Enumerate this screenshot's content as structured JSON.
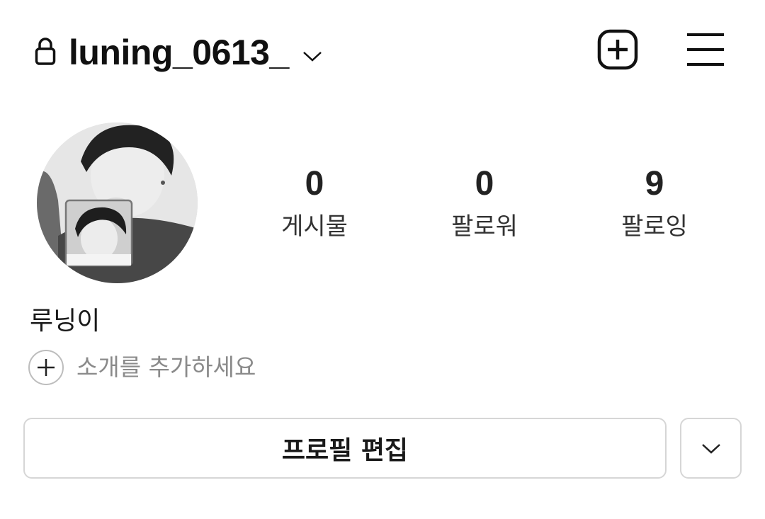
{
  "header": {
    "username": "luning_0613_",
    "icons": {
      "lock": "lock-icon",
      "account_switch": "chevron-down-icon",
      "new_post": "plus-square-icon",
      "menu": "hamburger-menu-icon"
    }
  },
  "profile": {
    "avatar": "profile-photo",
    "stats": [
      {
        "value": "0",
        "label": "게시물"
      },
      {
        "value": "0",
        "label": "팔로워"
      },
      {
        "value": "9",
        "label": "팔로잉"
      }
    ],
    "display_name": "루닝이",
    "add_bio_label": "소개를 추가하세요"
  },
  "actions": {
    "edit_profile_label": "프로필 편집",
    "more_icon": "chevron-down-icon"
  },
  "colors": {
    "background": "#ffffff",
    "text": "#1a1a1a",
    "muted": "#8a8a8a",
    "border": "#d6d6d6"
  }
}
